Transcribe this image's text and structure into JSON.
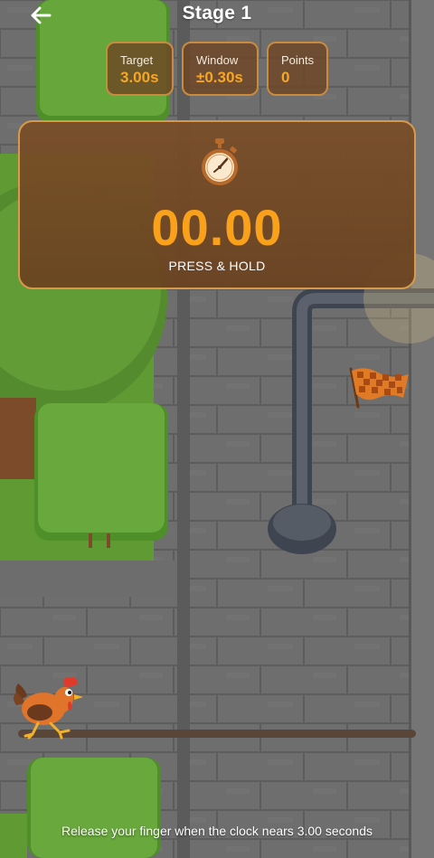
{
  "header": {
    "back_icon": "arrow-left-icon",
    "title": "Stage 1"
  },
  "stats": {
    "target": {
      "label": "Target",
      "value": "3.00s"
    },
    "window": {
      "label": "Window",
      "value": "±0.30s"
    },
    "points": {
      "label": "Points",
      "value": "0"
    }
  },
  "timer": {
    "icon": "stopwatch-icon",
    "value": "00.00",
    "action_label": "PRESS & HOLD"
  },
  "progress": {
    "fraction": 0.0
  },
  "hint": "Release your finger when the clock nears 3.00 seconds",
  "colors": {
    "accent": "#f9a11b",
    "panel": "#7a4e28",
    "panel_border": "#d89a4a",
    "track": "#5a4638",
    "wall": "#6f6f6f",
    "grass": "#5f9a32"
  }
}
